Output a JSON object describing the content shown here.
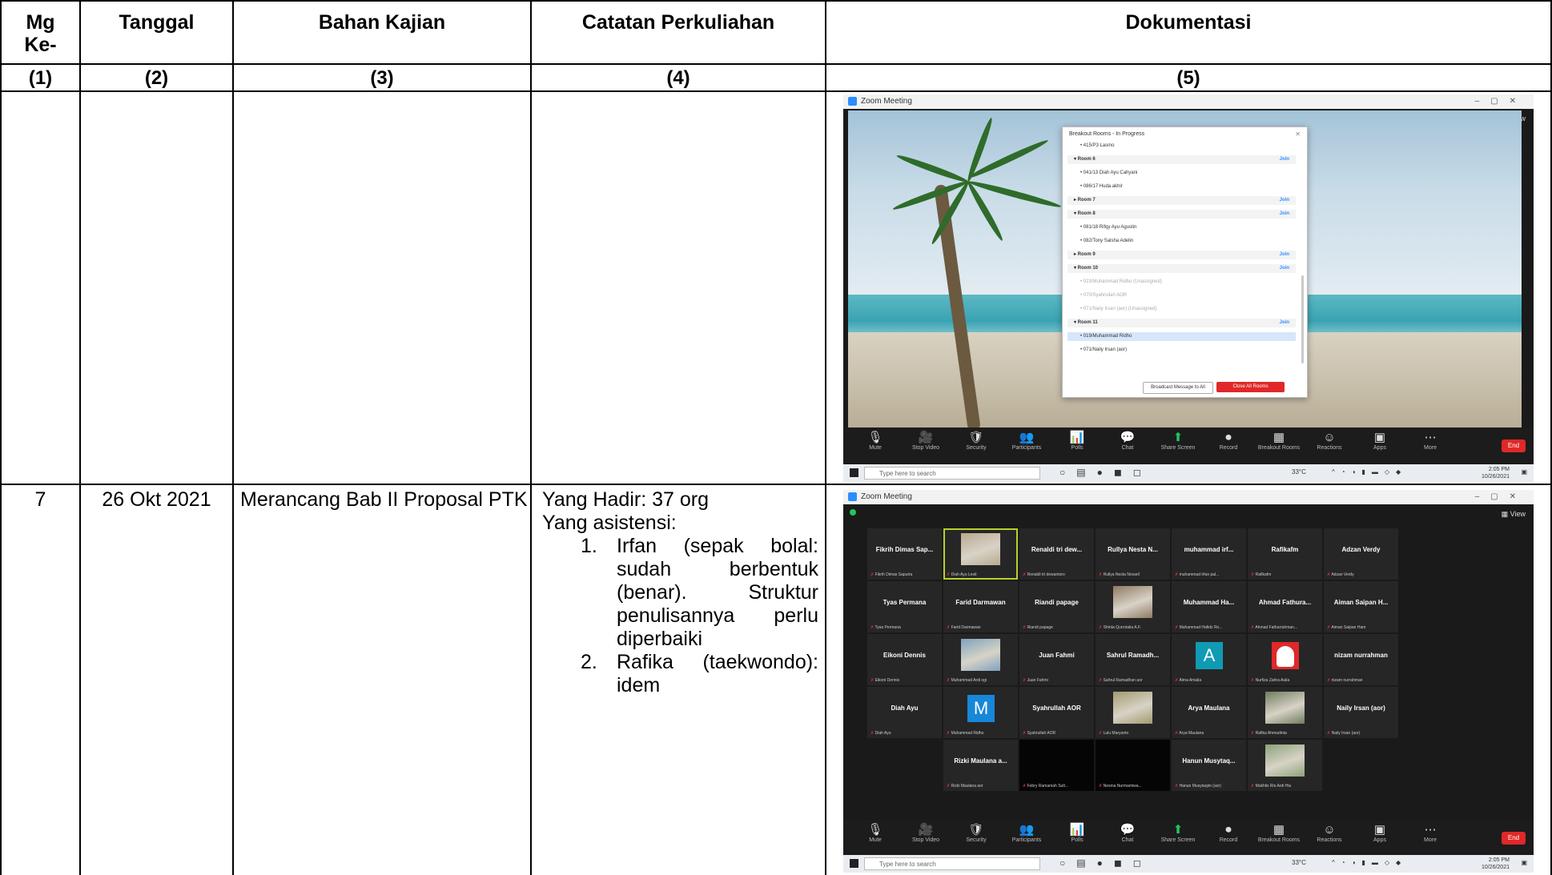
{
  "headers": [
    "Mg\nKe-",
    "Tanggal",
    "Bahan Kajian",
    "Catatan Perkuliahan",
    "Dokumentasi"
  ],
  "column_numbers": [
    "(1)",
    "(2)",
    "(3)",
    "(4)",
    "(5)"
  ],
  "rows": [
    {
      "mg": "",
      "tanggal": "",
      "bahan": "",
      "catatan": ""
    },
    {
      "mg": "7",
      "tanggal": "26 Okt 2021",
      "bahan": "Merancang Bab II Proposal PTK",
      "catatan": {
        "hadir": "Yang Hadir: 37 org",
        "asistensi": "Yang asistensi:",
        "items": [
          {
            "num": "1.",
            "text": "Irfan (sepak bolal: sudah berbentuk (benar). Struktur penulisannya perlu diperbaiki"
          },
          {
            "num": "2.",
            "text": "Rafika (taekwondo): idem"
          }
        ]
      }
    }
  ],
  "zoom": {
    "window_title": "Zoom Meeting",
    "view_label": "View",
    "toolbar": [
      "Mute",
      "Stop Video",
      "Security",
      "Participants",
      "Polls",
      "Chat",
      "Share Screen",
      "Record",
      "Breakout Rooms",
      "Reactions",
      "Apps",
      "More"
    ],
    "end_label": "End",
    "taskbar_search": "Type here to search",
    "weather": "33°C",
    "clock_time": "2:05 PM",
    "clock_date": "10/26/2021",
    "breakout": {
      "title": "Breakout Rooms - In Progress",
      "join": "Join",
      "rows": [
        {
          "kind": "person",
          "text": "• 415/P3 Lasmo"
        },
        {
          "kind": "room",
          "text": "▾ Room 6"
        },
        {
          "kind": "person",
          "text": "• 041/13 Diah Ayu Cahyani"
        },
        {
          "kind": "person",
          "text": "• 086/17 Huda akhir"
        },
        {
          "kind": "room",
          "text": "▸ Room 7"
        },
        {
          "kind": "room",
          "text": "▾ Room 8"
        },
        {
          "kind": "person",
          "text": "• 081/18 Rifqy Ayu Agustin"
        },
        {
          "kind": "person",
          "text": "• 082/Tony Salsha Adelin"
        },
        {
          "kind": "room",
          "text": "▸ Room 9"
        },
        {
          "kind": "room",
          "text": "▾ Room 10"
        },
        {
          "kind": "muted",
          "text": "• 023/Muhammad Ridho (Unassigned)"
        },
        {
          "kind": "muted",
          "text": "• 070/Syahrullah AOR"
        },
        {
          "kind": "muted",
          "text": "• 071/Naily Irsan (aor) (Unassigned)"
        },
        {
          "kind": "room",
          "text": "▾ Room 11"
        },
        {
          "kind": "selected",
          "text": "• 019/Muhammad Ridho"
        },
        {
          "kind": "person",
          "text": "• 071/Naily Irsan (aor)"
        }
      ],
      "broadcast_label": "Broadcast Message to All",
      "close_label": "Close All Rooms"
    },
    "gallery": [
      {
        "name": "Fikrih Dimas Sap...",
        "sub": "Fikrih Dimas Saputra",
        "kind": "name"
      },
      {
        "name": "",
        "sub": "Diah Ayu Lesti",
        "kind": "photo",
        "color": "#b9a98f",
        "active": true
      },
      {
        "name": "Renaldi tri dew...",
        "sub": "Renaldi tri dewantoro",
        "kind": "name"
      },
      {
        "name": "Rullya Nesta N...",
        "sub": "Rullya Nesta Novaril",
        "kind": "name"
      },
      {
        "name": "muhammad irf...",
        "sub": "muhammad irfan pal...",
        "kind": "name"
      },
      {
        "name": "Rafikafm",
        "sub": "Rafikafm",
        "kind": "name"
      },
      {
        "name": "Adzan Verdy",
        "sub": "Adzan Verdy",
        "kind": "name"
      },
      {
        "name": "Tyas Permana",
        "sub": "Tyas Permana",
        "kind": "name"
      },
      {
        "name": "Farid Darmawan",
        "sub": "Farid Darmawan",
        "kind": "name"
      },
      {
        "name": "Riandi papage",
        "sub": "Riandi papage",
        "kind": "name"
      },
      {
        "name": "",
        "sub": "Shinta Qurrotalia A.F.",
        "kind": "photo",
        "color": "#8f7a63"
      },
      {
        "name": "Muhammad Ha...",
        "sub": "Muhammad Hafidz Ro...",
        "kind": "name"
      },
      {
        "name": "Ahmad Fathura...",
        "sub": "Ahmad Fathurrahman...",
        "kind": "name"
      },
      {
        "name": "Aiman Saipan H...",
        "sub": "Aiman Saipan Ham",
        "kind": "name"
      },
      {
        "name": "Eikoni Dennis",
        "sub": "Eikoni Dennis",
        "kind": "name"
      },
      {
        "name": "",
        "sub": "Muhammad Ardi ogi",
        "kind": "photo",
        "color": "#7fa2bf"
      },
      {
        "name": "Juan Fahmi",
        "sub": "Juan Fahmi",
        "kind": "name"
      },
      {
        "name": "Sahrul Ramadh...",
        "sub": "Sahrul Ramadhan aor",
        "kind": "name"
      },
      {
        "name": "",
        "sub": "Alma Amalia",
        "kind": "avatar",
        "letter": "A",
        "color": "#0f9bb4"
      },
      {
        "name": "",
        "sub": "Nurfiza Zahra Aulia",
        "kind": "avatar-hijab",
        "color": "#e02828"
      },
      {
        "name": "nizam nurrahman",
        "sub": "nizam nurrahman",
        "kind": "name"
      },
      {
        "name": "Diah Ayu",
        "sub": "Diah Ayu",
        "kind": "name"
      },
      {
        "name": "",
        "sub": "Muhammad Ridho",
        "kind": "avatar",
        "letter": "M",
        "color": "#1787d8"
      },
      {
        "name": "Syahrullah AOR",
        "sub": "Syahrullah AOR",
        "kind": "name"
      },
      {
        "name": "",
        "sub": "Lulu Maryanto",
        "kind": "photo",
        "color": "#a39a6f"
      },
      {
        "name": "Arya Maulana",
        "sub": "Arya Maulana",
        "kind": "name"
      },
      {
        "name": "",
        "sub": "Rafika Ahmadinta",
        "kind": "photo",
        "color": "#6f7c5e"
      },
      {
        "name": "Naily Irsan (aor)",
        "sub": "Naily Irsan (aor)",
        "kind": "name"
      },
      {
        "name": "Rizki Maulana a...",
        "sub": "Rizki Maulana aor",
        "kind": "name"
      },
      {
        "name": "",
        "sub": "Febry Ramamah Sult...",
        "kind": "black"
      },
      {
        "name": "",
        "sub": "Nesma Nurmamiwa...",
        "kind": "black"
      },
      {
        "name": "Hanun Musytaq...",
        "sub": "Hanun Musytaqim (aor)",
        "kind": "name"
      },
      {
        "name": "",
        "sub": "Mukhlis Rio Ardi Hiu",
        "kind": "photo",
        "color": "#8da27a"
      }
    ]
  }
}
